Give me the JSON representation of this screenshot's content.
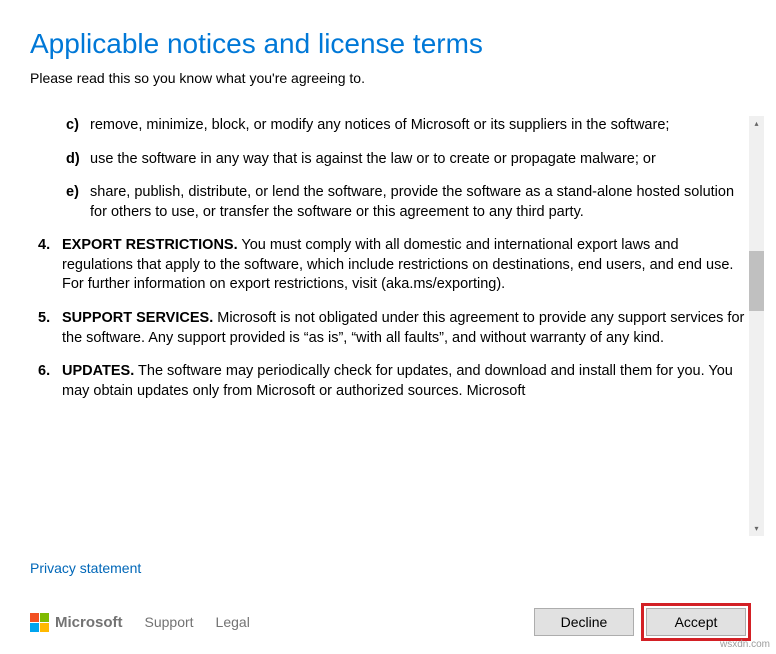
{
  "header": {
    "title": "Applicable notices and license terms",
    "subtitle": "Please read this so you know what you're agreeing to."
  },
  "terms": {
    "sub_items": [
      {
        "marker": "c)",
        "text": "remove, minimize, block, or modify any notices of Microsoft or its suppliers in the software;"
      },
      {
        "marker": "d)",
        "text": "use the software in any way that is against the law or to create or propagate malware; or"
      },
      {
        "marker": "e)",
        "text": "share, publish, distribute, or lend the software, provide the software as a stand-alone hosted solution for others to use, or transfer the software or this agreement to any third party."
      }
    ],
    "main_items": [
      {
        "num": "4.",
        "heading": "EXPORT RESTRICTIONS.",
        "text": " You must comply with all domestic and international export laws and regulations that apply to the software, which include restrictions on destinations, end users, and end use. For further information on export restrictions, visit (aka.ms/exporting)."
      },
      {
        "num": "5.",
        "heading": "SUPPORT SERVICES.",
        "text": " Microsoft is not obligated under this agreement to provide any support services for the software. Any support provided is “as is”, “with all faults”, and without warranty of any kind."
      },
      {
        "num": "6.",
        "heading": "UPDATES.",
        "text": " The software may periodically check for updates, and download and install them for you. You may obtain updates only from Microsoft or authorized sources. Microsoft"
      }
    ]
  },
  "links": {
    "privacy": "Privacy statement",
    "support": "Support",
    "legal": "Legal"
  },
  "brand": "Microsoft",
  "buttons": {
    "decline": "Decline",
    "accept": "Accept"
  },
  "watermark": "wsxdn.com"
}
